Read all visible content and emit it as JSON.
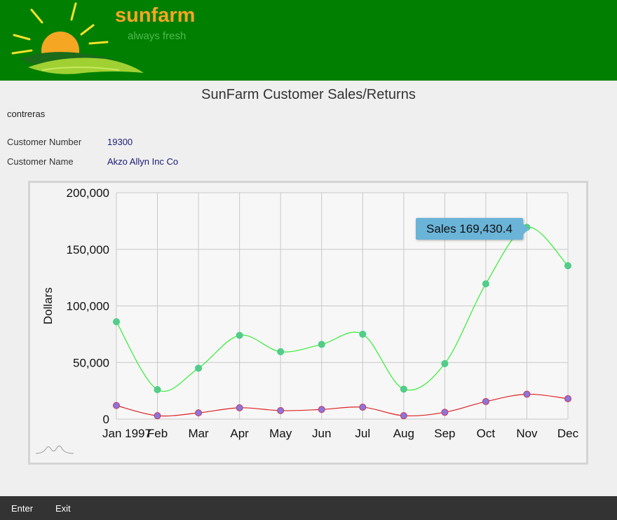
{
  "header": {
    "brand": "sunfarm",
    "tagline": "always fresh"
  },
  "page": {
    "title": "SunFarm Customer Sales/Returns",
    "user": "contreras"
  },
  "fields": {
    "customer_number_label": "Customer Number",
    "customer_number": "19300",
    "customer_name_label": "Customer Name",
    "customer_name": "Akzo Allyn Inc Co"
  },
  "tooltip": "Sales 169,430.4",
  "footer": {
    "enter": "Enter",
    "exit": "Exit"
  },
  "colors": {
    "header_bg": "#007f00",
    "sales_line": "#33ee33",
    "returns_line": "#dd2222",
    "sales_marker": "#55cc88",
    "returns_marker": "#8877dd"
  },
  "chart_data": {
    "type": "line",
    "ylabel": "Dollars",
    "categories": [
      "Jan 1997",
      "Feb",
      "Mar",
      "Apr",
      "May",
      "Jun",
      "Jul",
      "Aug",
      "Sep",
      "Oct",
      "Nov",
      "Dec"
    ],
    "ylim": [
      0,
      200000
    ],
    "yticks": [
      "0",
      "50,000",
      "100,000",
      "150,000",
      "200,000"
    ],
    "ytick_values": [
      0,
      50000,
      100000,
      150000,
      200000
    ],
    "grid": true,
    "series": [
      {
        "values": [
          86000,
          26000,
          45000,
          74000,
          59500,
          66000,
          75000,
          26500,
          49000,
          119500,
          169430.4,
          135500
        ]
      },
      {
        "values": [
          12000,
          3000,
          5500,
          10000,
          7500,
          8500,
          10500,
          3000,
          6000,
          15500,
          22000,
          18000
        ]
      }
    ]
  }
}
